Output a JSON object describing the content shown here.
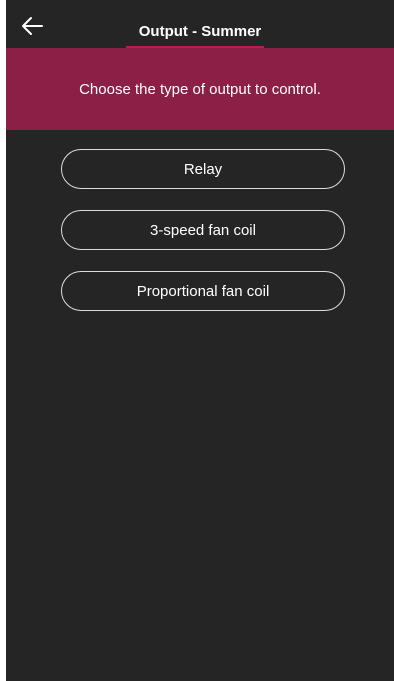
{
  "header": {
    "title": "Output - Summer",
    "back_icon": "arrow-left-icon"
  },
  "banner": {
    "text": "Choose the type of output to control."
  },
  "options": [
    {
      "label": "Relay"
    },
    {
      "label": "3-speed fan coil"
    },
    {
      "label": "Proportional fan coil"
    }
  ],
  "colors": {
    "background": "#252525",
    "banner": "#8b1f45",
    "accent": "#c2185b",
    "text": "#ffffff"
  }
}
